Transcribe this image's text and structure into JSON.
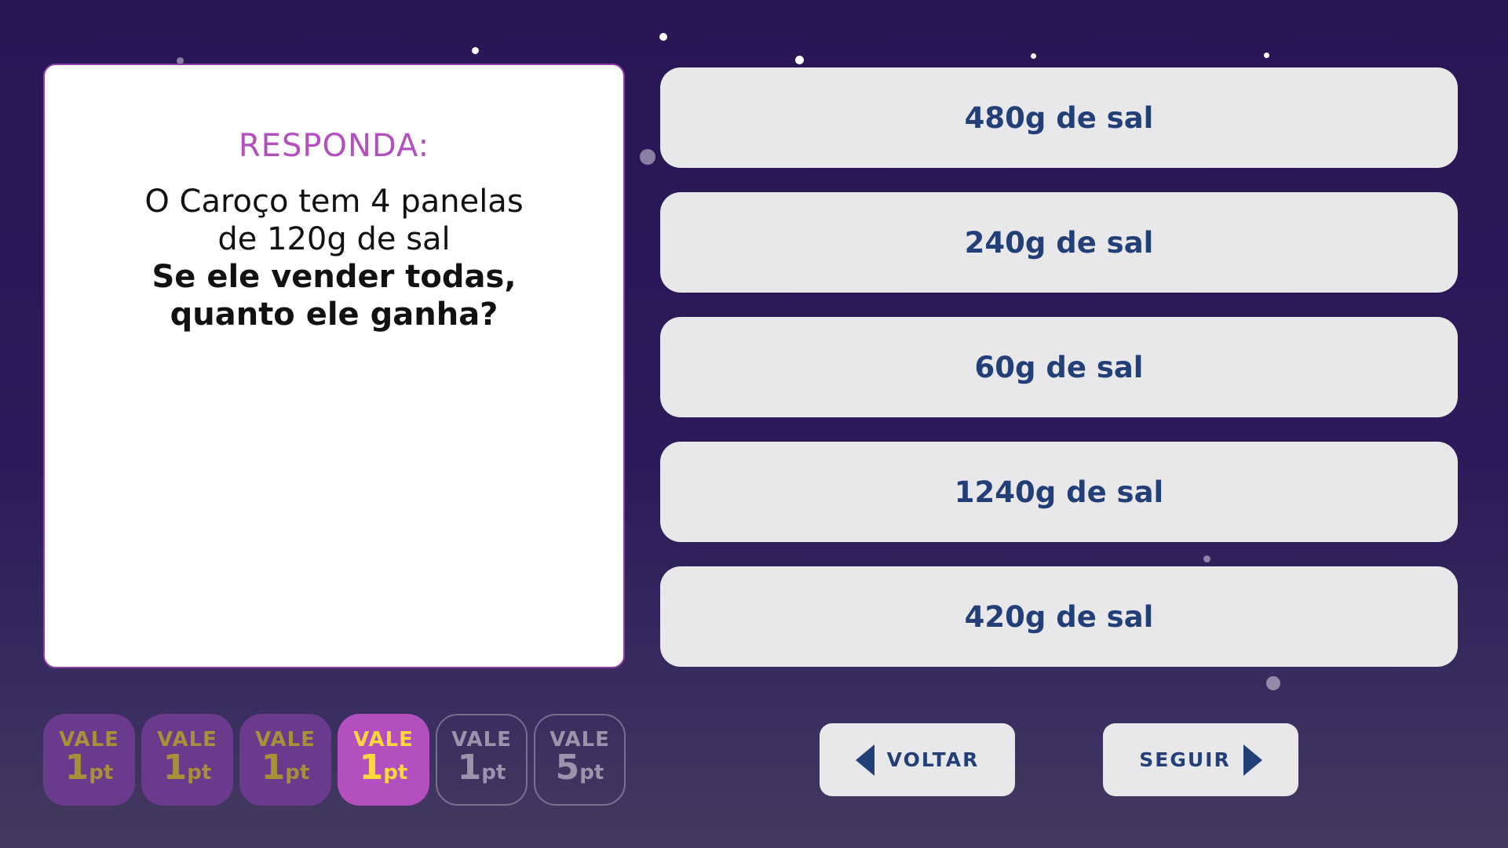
{
  "question": {
    "heading": "RESPONDA:",
    "line1": "O Caroço tem 4 panelas",
    "line2": "de 120g de sal",
    "line3": "Se ele vender todas,",
    "line4": "quanto ele ganha?"
  },
  "answers": [
    {
      "label": "480g de sal"
    },
    {
      "label": "240g de sal"
    },
    {
      "label": "60g de sal"
    },
    {
      "label": "1240g de sal"
    },
    {
      "label": "420g de sal"
    }
  ],
  "points": [
    {
      "vale": "VALE",
      "num": "1",
      "unit": "pt",
      "state": "done"
    },
    {
      "vale": "VALE",
      "num": "1",
      "unit": "pt",
      "state": "done"
    },
    {
      "vale": "VALE",
      "num": "1",
      "unit": "pt",
      "state": "done"
    },
    {
      "vale": "VALE",
      "num": "1",
      "unit": "pt",
      "state": "current"
    },
    {
      "vale": "VALE",
      "num": "1",
      "unit": "pt",
      "state": "pending"
    },
    {
      "vale": "VALE",
      "num": "5",
      "unit": "pt",
      "state": "pending"
    }
  ],
  "nav": {
    "back_label": "VOLTAR",
    "next_label": "SEGUIR"
  },
  "colors": {
    "background": "#2a1655",
    "heading": "#b44fbf",
    "answer_text": "#233f78",
    "answer_bg": "#e8e8ea",
    "badge_done": "#6a3a8c",
    "badge_current": "#b44fbf",
    "badge_current_text": "#ffd93a"
  },
  "icons": {
    "back": "arrow-left-icon",
    "next": "arrow-right-icon"
  }
}
